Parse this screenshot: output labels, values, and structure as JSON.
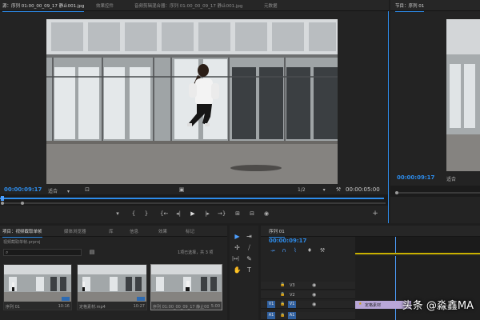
{
  "source_monitor": {
    "tabs": [
      "源：序列 01:00_00_09_17 静止001.jpg",
      "效果控件",
      "音频剪辑混合器：序列 01:00_00_09_17 静止001.jpg",
      "元数据"
    ],
    "timecode": "00:00:09:17",
    "fit_label": "适合",
    "fit_arrow": "▾",
    "resolution": "1/2",
    "duration": "00:00:05:00",
    "playhead_fraction": 0.0
  },
  "program_monitor": {
    "title": "节目：序列 01",
    "timecode": "00:00:09:17",
    "fit_label": "适合"
  },
  "transport_icons": [
    "marker-icon",
    "in-point-icon",
    "out-point-icon",
    "go-to-in-icon",
    "step-back-icon",
    "play-icon",
    "step-forward-icon",
    "go-to-out-icon",
    "insert-icon",
    "overwrite-icon",
    "export-frame-icon"
  ],
  "transport_glyphs": [
    "▾",
    "{",
    "}",
    "{←",
    "◂|",
    "▶",
    "|▸",
    "→}",
    "⊞",
    "⊟",
    "◉"
  ],
  "add_button_glyph": "+",
  "project": {
    "tabs": [
      "项目：视频截取单帧",
      "媒体浏览器",
      "库",
      "信息",
      "效果",
      "标记"
    ],
    "project_file": "视频截取单帧.prproj",
    "search_icon_glyph": "⌕",
    "selection_info": "1项已选择，共 3 项",
    "items": [
      {
        "name": "序列 01",
        "duration": "10:16"
      },
      {
        "name": "定格素材.mp4",
        "duration": "10:27"
      },
      {
        "name": "序列 01:00_00_09_17 静止001.jpg",
        "duration": "5:00"
      }
    ]
  },
  "tools": [
    "selection-tool-icon",
    "track-select-icon",
    "ripple-edit-icon",
    "razor-tool-icon",
    "slip-tool-icon",
    "pen-tool-icon",
    "hand-tool-icon",
    "type-tool-icon"
  ],
  "tool_glyphs": [
    "▶",
    "⇥",
    "✢",
    "⧸",
    "|↔|",
    "✎",
    "✋",
    "T"
  ],
  "timeline": {
    "tab": "序列 01",
    "timecode": "00:00:09:17",
    "control_glyphs": [
      "⤞",
      "∩",
      "⌇",
      "♦",
      "⚒"
    ],
    "tracks": [
      {
        "label": "V3",
        "target": ""
      },
      {
        "label": "V2",
        "target": ""
      },
      {
        "label": "V1",
        "target": "V1"
      },
      {
        "label": "A1",
        "target": "A1"
      }
    ],
    "lock_glyph": "🔒",
    "eye_glyph": "◉",
    "clip_label": "定格素材"
  },
  "watermark": "头条 @淼鑫MA"
}
